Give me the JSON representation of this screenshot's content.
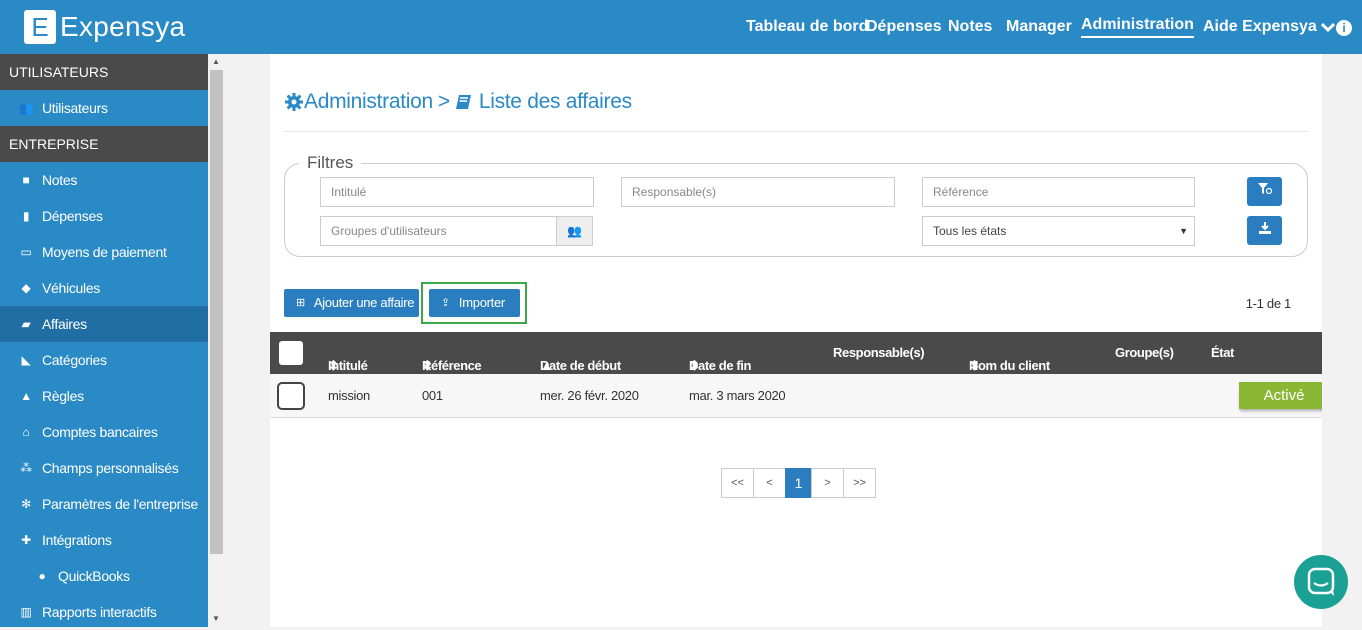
{
  "topbar": {
    "logo_letter": "E",
    "logo_text": "Expensya",
    "nav": [
      "Tableau de bord",
      "Dépenses",
      "Notes",
      "Manager",
      "Administration"
    ],
    "help": "Aide Expensya",
    "help_chevron": "chevron-down-icon",
    "info": "info-icon"
  },
  "sidebar": {
    "section_users": "UTILISATEURS",
    "users_item": "Utilisateurs",
    "section_company": "ENTREPRISE",
    "items": [
      "Notes",
      "Dépenses",
      "Moyens de paiement",
      "Véhicules",
      "Affaires",
      "Catégories",
      "Règles",
      "Comptes bancaires",
      "Champs personnalisés",
      "Paramètres de l'entreprise",
      "Intégrations"
    ],
    "sub_item": "QuickBooks",
    "last_item": "Rapports interactifs",
    "active_item": "Affaires"
  },
  "page": {
    "bc_admin": "Administration",
    "bc_sep": ">",
    "bc_current": "Liste des affaires"
  },
  "filters": {
    "legend": "Filtres",
    "intitule_ph": "Intitulé",
    "responsable_ph": "Responsable(s)",
    "reference_ph": "Référence",
    "groupes_ph": "Groupes d'utilisateurs",
    "etat_value": "Tous les états"
  },
  "actions": {
    "add": "Ajouter une affaire",
    "import": "Importer",
    "count": "1-1 de 1"
  },
  "table": {
    "headers": [
      "Intitulé",
      "Référence",
      "Date de début",
      "Date de fin",
      "Responsable(s)",
      "Nom du client",
      "Groupe(s)",
      "État"
    ],
    "sort_glyphs": [
      "⬍",
      "⬍",
      "▲",
      "⬍",
      "⬍"
    ],
    "rows": [
      {
        "intitule": "mission",
        "reference": "001",
        "debut": "mer. 26 févr. 2020",
        "fin": "mar. 3 mars 2020",
        "etat": "Activé"
      }
    ]
  },
  "pagination": [
    "<<",
    "<",
    "1",
    ">",
    ">>"
  ],
  "colors": {
    "primary": "#2a8ac6",
    "dark": "#4a4a4a",
    "active_badge": "#8ab834",
    "highlight": "#3aa847",
    "chat": "#1aa094"
  }
}
